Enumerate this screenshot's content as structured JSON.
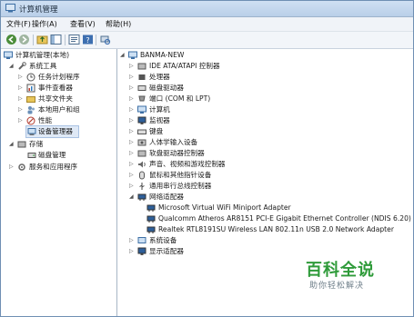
{
  "window": {
    "title": "计算机管理"
  },
  "menu": {
    "items": [
      "文件(F)",
      "操作(A)",
      "查看(V)",
      "帮助(H)"
    ]
  },
  "toolbar": {
    "icons": [
      "back-arrow-icon",
      "forward-arrow-icon",
      "up-folder-icon",
      "show-hide-tree-icon",
      "help-icon",
      "properties-icon",
      "scan-hardware-icon"
    ]
  },
  "left_tree": {
    "root": "计算机管理(本地)",
    "system_tools": "系统工具",
    "items": [
      "任务计划程序",
      "事件查看器",
      "共享文件夹",
      "本地用户和组",
      "性能",
      "设备管理器"
    ],
    "storage": "存储",
    "disk_mgmt": "磁盘管理",
    "services": "服务和应用程序"
  },
  "device_tree": {
    "root": "BANMA-NEW",
    "categories": [
      "IDE ATA/ATAPI 控制器",
      "处理器",
      "磁盘驱动器",
      "端口 (COM 和 LPT)",
      "计算机",
      "监视器",
      "键盘",
      "人体学输入设备",
      "软盘驱动器控制器",
      "声音、视频和游戏控制器",
      "鼠标和其他指针设备",
      "通用串行总线控制器",
      "网络适配器"
    ],
    "network_children": [
      "Microsoft Virtual WiFi Miniport Adapter",
      "Qualcomm Atheros AR8151 PCI-E Gigabit Ethernet Controller (NDIS 6.20)",
      "Realtek RTL8191SU Wireless LAN 802.11n USB 2.0 Network Adapter"
    ],
    "after": [
      "系统设备",
      "显示适配器"
    ]
  },
  "watermark": {
    "main": "百科全说",
    "sub": "助你轻松解决"
  },
  "colors": {
    "title_bar": "#c4d8ef",
    "selection": "#dfe9f6",
    "watermark": "#2f9b3a"
  }
}
